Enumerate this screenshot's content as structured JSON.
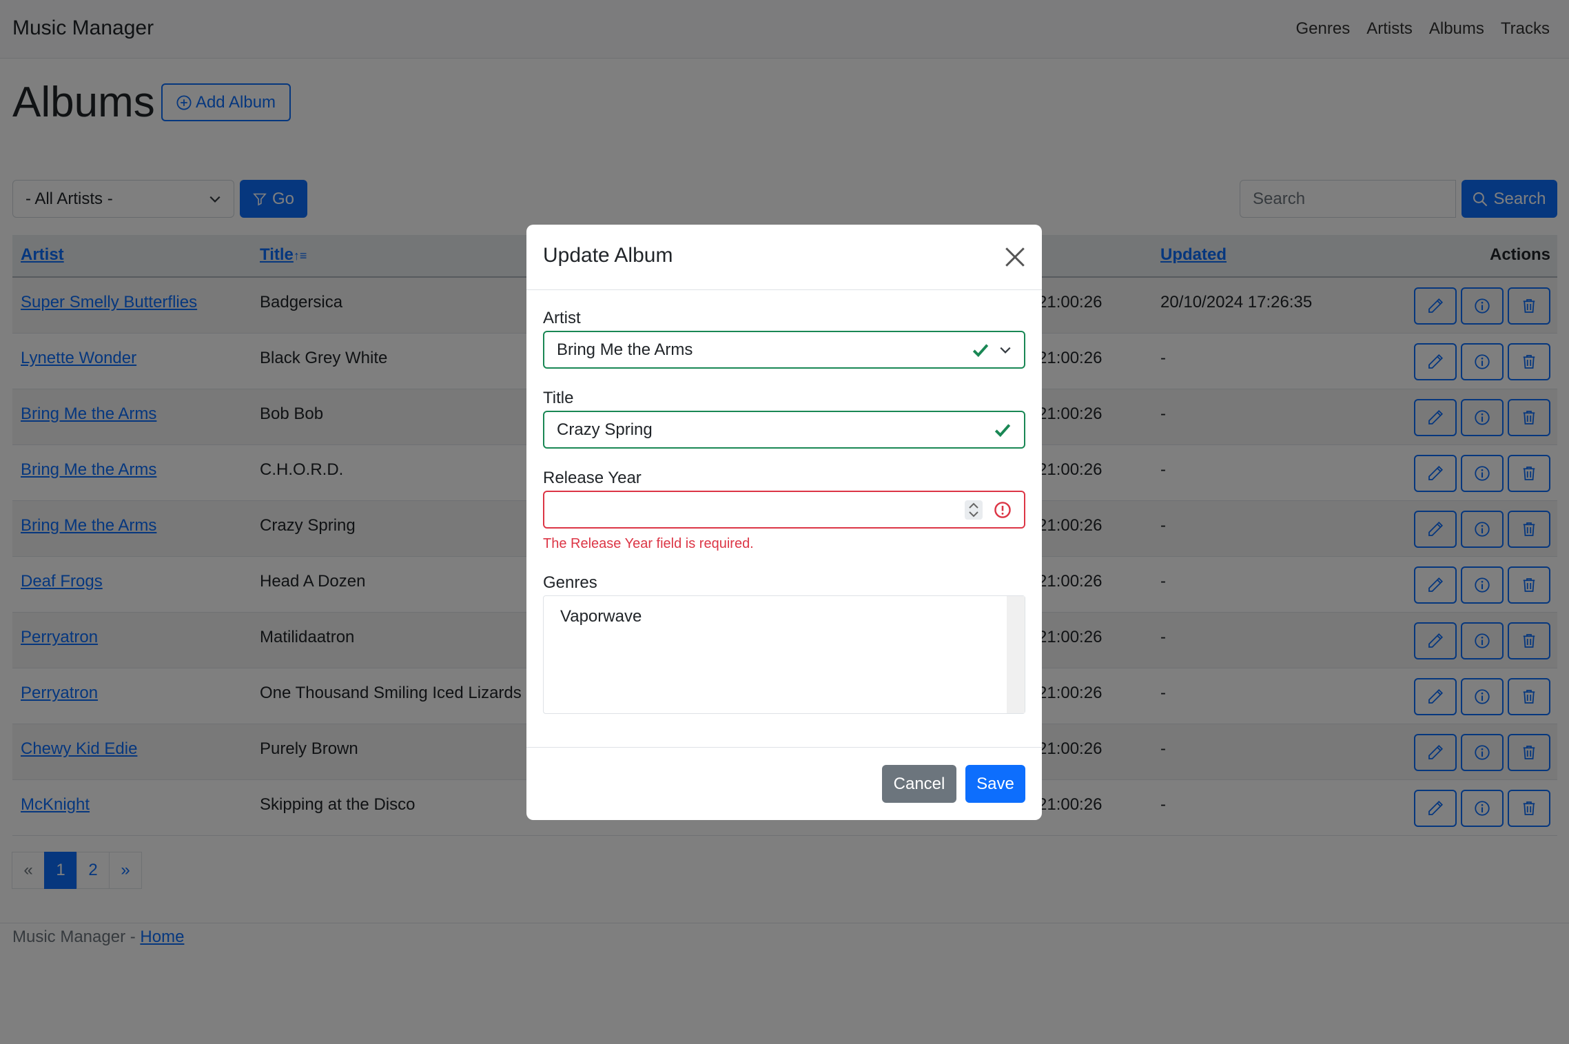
{
  "app": {
    "brand": "Music Manager",
    "nav": [
      "Genres",
      "Artists",
      "Albums",
      "Tracks"
    ]
  },
  "page": {
    "title": "Albums",
    "add_button": "Add Album"
  },
  "filters": {
    "artist_select_value": "- All Artists -",
    "go_label": "Go",
    "search_placeholder": "Search",
    "search_button": "Search"
  },
  "table": {
    "headers": {
      "artist": "Artist",
      "title": "Title",
      "updated": "Updated",
      "actions": "Actions"
    },
    "rows": [
      {
        "artist": "Super Smelly Butterflies",
        "title": "Badgersica",
        "created": "21:00:26",
        "updated": "20/10/2024 17:26:35"
      },
      {
        "artist": "Lynette Wonder",
        "title": "Black Grey White",
        "created": "21:00:26",
        "updated": "-"
      },
      {
        "artist": "Bring Me the Arms",
        "title": "Bob Bob",
        "created": "21:00:26",
        "updated": "-"
      },
      {
        "artist": "Bring Me the Arms",
        "title": "C.H.O.R.D.",
        "created": "21:00:26",
        "updated": "-"
      },
      {
        "artist": "Bring Me the Arms",
        "title": "Crazy Spring",
        "created": "21:00:26",
        "updated": "-"
      },
      {
        "artist": "Deaf Frogs",
        "title": "Head A Dozen",
        "created": "21:00:26",
        "updated": "-"
      },
      {
        "artist": "Perryatron",
        "title": "Matilidaatron",
        "created": "21:00:26",
        "updated": "-"
      },
      {
        "artist": "Perryatron",
        "title": "One Thousand Smiling Iced Lizards",
        "created": "21:00:26",
        "updated": "-"
      },
      {
        "artist": "Chewy Kid Edie",
        "title": "Purely Brown",
        "created": "21:00:26",
        "updated": "-"
      },
      {
        "artist": "McKnight",
        "title": "Skipping at the Disco",
        "created": "21:00:26",
        "updated": "-"
      }
    ]
  },
  "pagination": [
    "«",
    "1",
    "2",
    "»"
  ],
  "footer": {
    "text": "Music Manager - ",
    "link": "Home"
  },
  "modal": {
    "title": "Update Album",
    "artist_label": "Artist",
    "artist_value": "Bring Me the Arms",
    "title_label": "Title",
    "title_value": "Crazy Spring",
    "release_year_label": "Release Year",
    "release_year_value": "",
    "release_year_error": "The Release Year field is required.",
    "genres_label": "Genres",
    "genres": [
      "Vaporwave"
    ],
    "cancel_label": "Cancel",
    "save_label": "Save"
  },
  "colors": {
    "primary": "#0d6efd",
    "valid": "#198754",
    "invalid": "#dc3545",
    "secondary": "#6c757d"
  }
}
